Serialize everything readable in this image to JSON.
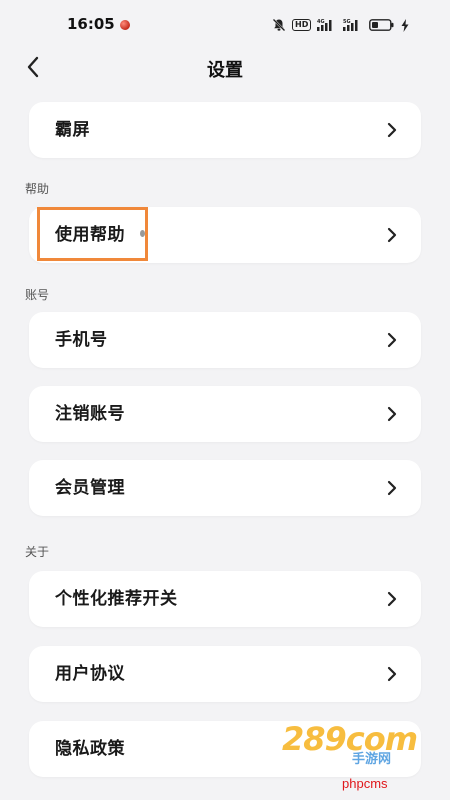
{
  "status_bar": {
    "time": "16:05",
    "hd_label": "HD",
    "signal_1_label": "4G",
    "signal_2_label": "5G"
  },
  "header": {
    "title": "设置",
    "back_icon": "chevron-left-icon"
  },
  "sections": {
    "help": "帮助",
    "account": "账号",
    "about": "关于"
  },
  "items": {
    "screen": "霸屏",
    "help": "使用帮助",
    "phone": "手机号",
    "cancel_account": "注销账号",
    "member": "会员管理",
    "personalized": "个性化推荐开关",
    "user_agreement": "用户协议",
    "privacy": "隐私政策"
  },
  "watermark": {
    "big": "289com",
    "small": "手游网",
    "footer": "phpcms"
  },
  "colors": {
    "background": "#f3f3f5",
    "card": "#ffffff",
    "highlight": "#f0883a"
  }
}
